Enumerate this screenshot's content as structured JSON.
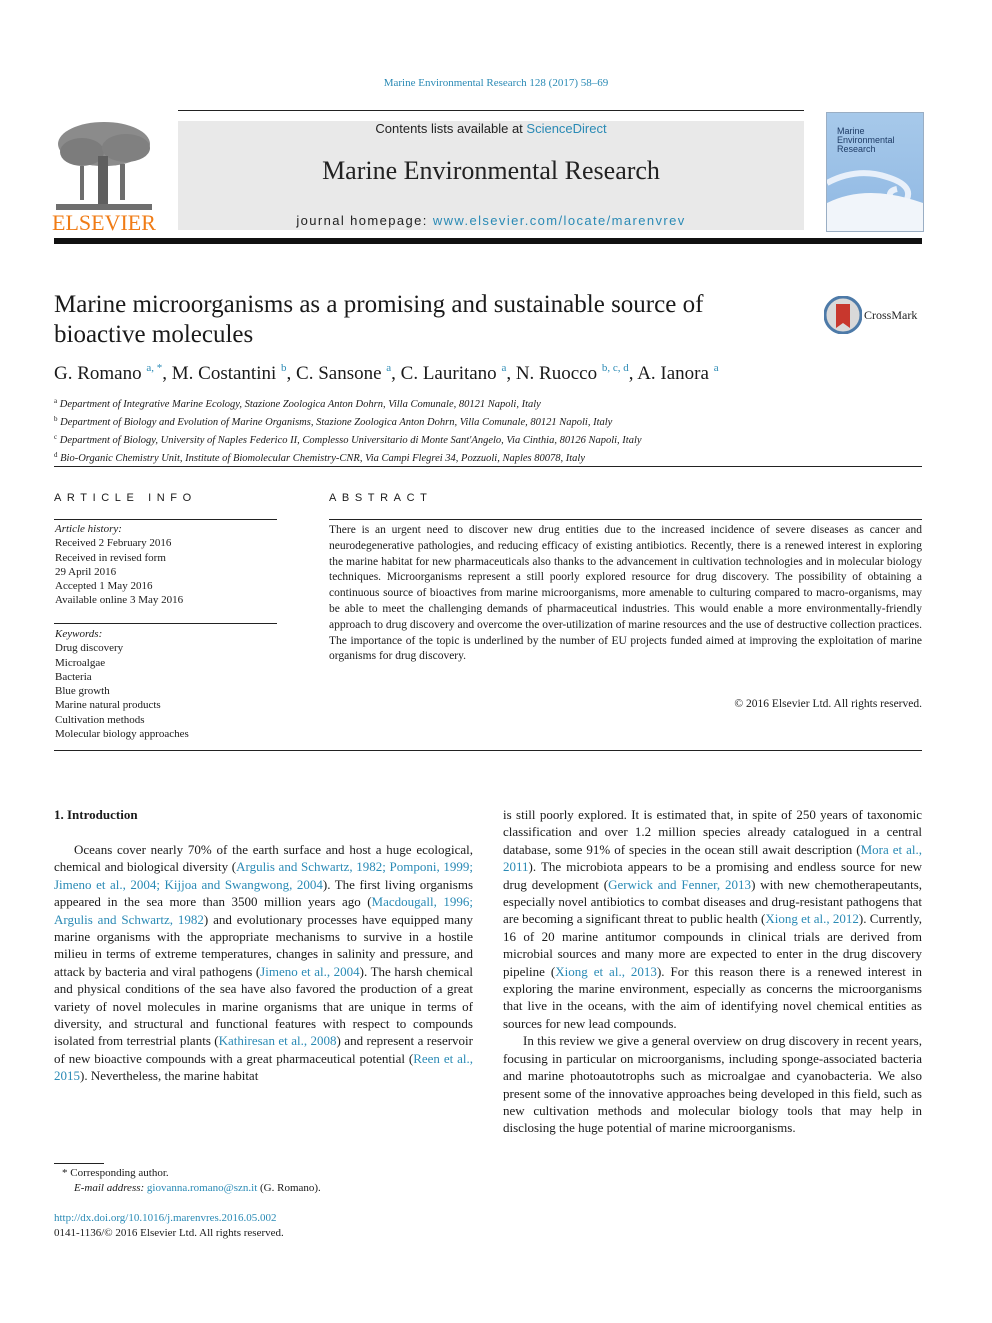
{
  "header": {
    "citation": "Marine Environmental Research 128 (2017) 58–69",
    "contents_prefix": "Contents lists available at ",
    "contents_link": "ScienceDirect",
    "journal_title": "Marine Environmental Research",
    "homepage_prefix": "journal homepage: ",
    "homepage_link": "www.elsevier.com/locate/marenvrev",
    "publisher_logo_text": "ELSEVIER",
    "cover_title_1": "Marine",
    "cover_title_2": "Environmental",
    "cover_title_3": "Research",
    "crossmark_label": "CrossMark"
  },
  "article": {
    "title": "Marine microorganisms as a promising and sustainable source of bioactive molecules",
    "authors": [
      {
        "name": "G. Romano",
        "sup": "a, *"
      },
      {
        "name": "M. Costantini",
        "sup": "b"
      },
      {
        "name": "C. Sansone",
        "sup": "a"
      },
      {
        "name": "C. Lauritano",
        "sup": "a"
      },
      {
        "name": "N. Ruocco",
        "sup": "b, c, d"
      },
      {
        "name": "A. Ianora",
        "sup": "a"
      }
    ],
    "affiliations": [
      {
        "key": "a",
        "text": "Department of Integrative Marine Ecology, Stazione Zoologica Anton Dohrn, Villa Comunale, 80121 Napoli, Italy"
      },
      {
        "key": "b",
        "text": "Department of Biology and Evolution of Marine Organisms, Stazione Zoologica Anton Dohrn, Villa Comunale, 80121 Napoli, Italy"
      },
      {
        "key": "c",
        "text": "Department of Biology, University of Naples Federico II, Complesso Universitario di Monte Sant'Angelo, Via Cinthia, 80126 Napoli, Italy"
      },
      {
        "key": "d",
        "text": "Bio-Organic Chemistry Unit, Institute of Biomolecular Chemistry-CNR, Via Campi Flegrei 34, Pozzuoli, Naples 80078, Italy"
      }
    ]
  },
  "article_info": {
    "heading": "ARTICLE INFO",
    "history_label": "Article history:",
    "history": [
      "Received 2 February 2016",
      "Received in revised form",
      "29 April 2016",
      "Accepted 1 May 2016",
      "Available online 3 May 2016"
    ],
    "keywords_label": "Keywords:",
    "keywords": [
      "Drug discovery",
      "Microalgae",
      "Bacteria",
      "Blue growth",
      "Marine natural products",
      "Cultivation methods",
      "Molecular biology approaches"
    ]
  },
  "abstract": {
    "heading": "ABSTRACT",
    "text": "There is an urgent need to discover new drug entities due to the increased incidence of severe diseases as cancer and neurodegenerative pathologies, and reducing efficacy of existing antibiotics. Recently, there is a renewed interest in exploring the marine habitat for new pharmaceuticals also thanks to the advancement in cultivation technologies and in molecular biology techniques. Microorganisms represent a still poorly explored resource for drug discovery. The possibility of obtaining a continuous source of bioactives from marine microorganisms, more amenable to culturing compared to macro-organisms, may be able to meet the challenging demands of pharmaceutical industries. This would enable a more environmentally-friendly approach to drug discovery and overcome the over-utilization of marine resources and the use of destructive collection practices. The importance of the topic is underlined by the number of EU projects funded aimed at improving the exploitation of marine organisms for drug discovery.",
    "copyright": "© 2016 Elsevier Ltd. All rights reserved."
  },
  "body": {
    "section_heading": "1.  Introduction",
    "left_column": [
      {
        "t": "Oceans cover nearly 70% of the earth surface and host a huge ecological, chemical and biological diversity ("
      },
      {
        "link": "Argulis and Schwartz, 1982; Pomponi, 1999; Jimeno et al., 2004; Kijjoa and Swangwong, 2004"
      },
      {
        "t": "). The first living organisms appeared in the sea more than 3500 million years ago ("
      },
      {
        "link": "Macdougall, 1996; Argulis and Schwartz, 1982"
      },
      {
        "t": ") and evolutionary processes have equipped many marine organisms with the appropriate mechanisms to survive in a hostile milieu in terms of extreme temperatures, changes in salinity and pressure, and attack by bacteria and viral pathogens ("
      },
      {
        "link": "Jimeno et al., 2004"
      },
      {
        "t": "). The harsh chemical and physical conditions of the sea have also favored the production of a great variety of novel molecules in marine organisms that are unique in terms of diversity, and structural and functional features with respect to compounds isolated from terrestrial plants ("
      },
      {
        "link": "Kathiresan et al., 2008"
      },
      {
        "t": ") and represent a reservoir of new bioactive compounds with a great pharmaceutical potential ("
      },
      {
        "link": "Reen et al., 2015"
      },
      {
        "t": "). Nevertheless, the marine habitat"
      }
    ],
    "right_paragraph_1": [
      {
        "t": "is still poorly explored. It is estimated that, in spite of 250 years of taxonomic classification and over 1.2 million species already catalogued in a central database, some 91% of species in the ocean still await description ("
      },
      {
        "link": "Mora et al., 2011"
      },
      {
        "t": "). The microbiota appears to be a promising and endless source for new drug development ("
      },
      {
        "link": "Gerwick and Fenner, 2013"
      },
      {
        "t": ") with new chemotherapeutants, especially novel antibiotics to combat diseases and drug-resistant pathogens that are becoming a significant threat to public health ("
      },
      {
        "link": "Xiong et al., 2012"
      },
      {
        "t": "). Currently, 16 of 20 marine antitumor compounds in clinical trials are derived from microbial sources and many more are expected to enter in the drug discovery pipeline ("
      },
      {
        "link": "Xiong et al., 2013"
      },
      {
        "t": "). For this reason there is a renewed interest in exploring the marine environment, especially as concerns the microorganisms that live in the oceans, with the aim of identifying novel chemical entities as sources for new lead compounds."
      }
    ],
    "right_paragraph_2": "In this review we give a general overview on drug discovery in recent years, focusing in particular on microorganisms, including sponge-associated bacteria and marine photoautotrophs such as microalgae and cyanobacteria. We also present some of the innovative approaches being developed in this field, such as new cultivation methods and molecular biology tools that may help in disclosing the huge potential of marine microorganisms."
  },
  "footnote": {
    "corresponding": "* Corresponding author.",
    "email_label": "E-mail address: ",
    "email": "giovanna.romano@szn.it",
    "email_suffix": " (G. Romano).",
    "doi": "http://dx.doi.org/10.1016/j.marenvres.2016.05.002",
    "issn_copyright": "0141-1136/© 2016 Elsevier Ltd. All rights reserved."
  },
  "colors": {
    "link": "#2a8ab5",
    "elsevier_orange": "#f07c16",
    "banner_bg": "#e9e9e9"
  }
}
